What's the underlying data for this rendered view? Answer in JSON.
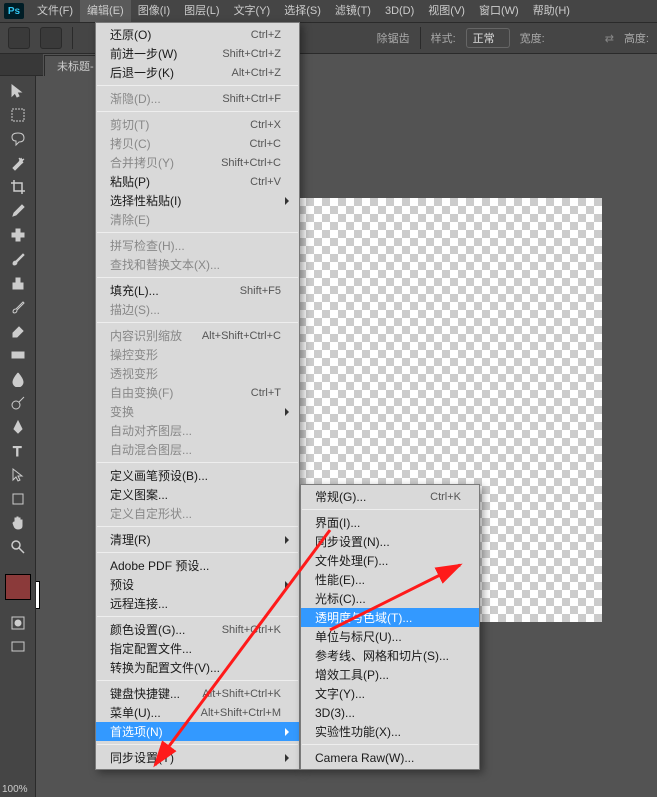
{
  "menubar": {
    "items": [
      "文件(F)",
      "编辑(E)",
      "图像(I)",
      "图层(L)",
      "文字(Y)",
      "选择(S)",
      "滤镜(T)",
      "3D(D)",
      "视图(V)",
      "窗口(W)",
      "帮助(H)"
    ],
    "active_index": 1
  },
  "options": {
    "eliminate_gaps": "除锯齿",
    "style_label": "样式:",
    "style_value": "正常",
    "width_label": "宽度:",
    "height_label": "高度:"
  },
  "doc_tab": "未标题-",
  "zoom": "100%",
  "edit_menu": [
    {
      "label": "还原(O)",
      "shortcut": "Ctrl+Z"
    },
    {
      "label": "前进一步(W)",
      "shortcut": "Shift+Ctrl+Z"
    },
    {
      "label": "后退一步(K)",
      "shortcut": "Alt+Ctrl+Z"
    },
    {
      "sep": true
    },
    {
      "label": "渐隐(D)...",
      "shortcut": "Shift+Ctrl+F",
      "disabled": true
    },
    {
      "sep": true
    },
    {
      "label": "剪切(T)",
      "shortcut": "Ctrl+X",
      "disabled": true
    },
    {
      "label": "拷贝(C)",
      "shortcut": "Ctrl+C",
      "disabled": true
    },
    {
      "label": "合并拷贝(Y)",
      "shortcut": "Shift+Ctrl+C",
      "disabled": true
    },
    {
      "label": "粘贴(P)",
      "shortcut": "Ctrl+V"
    },
    {
      "label": "选择性粘贴(I)",
      "submenu": true
    },
    {
      "label": "清除(E)",
      "disabled": true
    },
    {
      "sep": true
    },
    {
      "label": "拼写检查(H)...",
      "disabled": true
    },
    {
      "label": "查找和替换文本(X)...",
      "disabled": true
    },
    {
      "sep": true
    },
    {
      "label": "填充(L)...",
      "shortcut": "Shift+F5"
    },
    {
      "label": "描边(S)...",
      "disabled": true
    },
    {
      "sep": true
    },
    {
      "label": "内容识别缩放",
      "shortcut": "Alt+Shift+Ctrl+C",
      "disabled": true
    },
    {
      "label": "操控变形",
      "disabled": true
    },
    {
      "label": "透视变形",
      "disabled": true
    },
    {
      "label": "自由变换(F)",
      "shortcut": "Ctrl+T",
      "disabled": true
    },
    {
      "label": "变换",
      "submenu": true,
      "disabled": true
    },
    {
      "label": "自动对齐图层...",
      "disabled": true
    },
    {
      "label": "自动混合图层...",
      "disabled": true
    },
    {
      "sep": true
    },
    {
      "label": "定义画笔预设(B)..."
    },
    {
      "label": "定义图案..."
    },
    {
      "label": "定义自定形状...",
      "disabled": true
    },
    {
      "sep": true
    },
    {
      "label": "清理(R)",
      "submenu": true
    },
    {
      "sep": true
    },
    {
      "label": "Adobe PDF 预设..."
    },
    {
      "label": "预设",
      "submenu": true
    },
    {
      "label": "远程连接..."
    },
    {
      "sep": true
    },
    {
      "label": "颜色设置(G)...",
      "shortcut": "Shift+Ctrl+K"
    },
    {
      "label": "指定配置文件..."
    },
    {
      "label": "转换为配置文件(V)..."
    },
    {
      "sep": true
    },
    {
      "label": "键盘快捷键...",
      "shortcut": "Alt+Shift+Ctrl+K"
    },
    {
      "label": "菜单(U)...",
      "shortcut": "Alt+Shift+Ctrl+M"
    },
    {
      "label": "首选项(N)",
      "submenu": true,
      "highlight": true
    },
    {
      "sep": true
    },
    {
      "label": "同步设置(Y)",
      "submenu": true
    }
  ],
  "prefs_menu": [
    {
      "label": "常规(G)...",
      "shortcut": "Ctrl+K"
    },
    {
      "sep": true
    },
    {
      "label": "界面(I)..."
    },
    {
      "label": "同步设置(N)..."
    },
    {
      "label": "文件处理(F)..."
    },
    {
      "label": "性能(E)..."
    },
    {
      "label": "光标(C)..."
    },
    {
      "label": "透明度与色域(T)...",
      "highlight": true
    },
    {
      "label": "单位与标尺(U)..."
    },
    {
      "label": "参考线、网格和切片(S)..."
    },
    {
      "label": "增效工具(P)..."
    },
    {
      "label": "文字(Y)..."
    },
    {
      "label": "3D(3)..."
    },
    {
      "label": "实验性功能(X)..."
    },
    {
      "sep": true
    },
    {
      "label": "Camera Raw(W)..."
    }
  ]
}
